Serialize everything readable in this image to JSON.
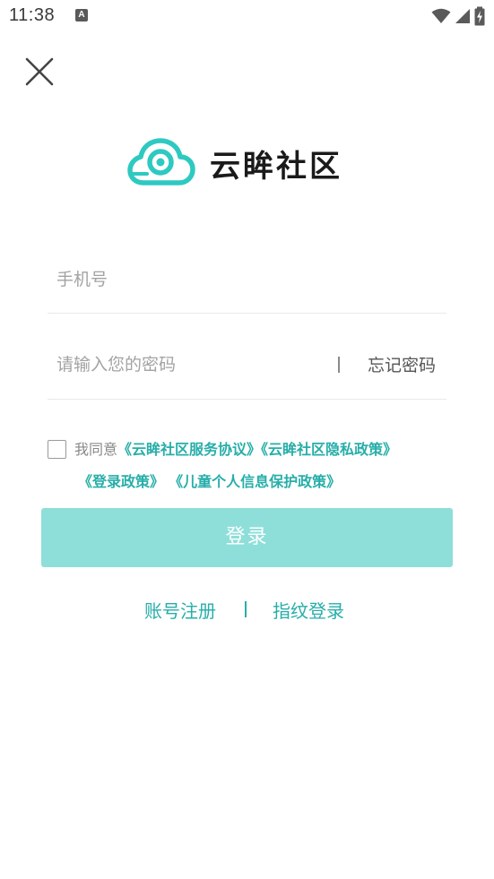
{
  "status_bar": {
    "time": "11:38",
    "notification_icon": "A"
  },
  "logo": {
    "text": "云眸社区",
    "icon": "cloud-eye-icon",
    "color": "#2ec9c1"
  },
  "form": {
    "phone_placeholder": "手机号",
    "password_placeholder": "请输入您的密码",
    "separator": "|",
    "forgot_password": "忘记密码"
  },
  "agreement": {
    "checked": false,
    "prefix": "我同意",
    "policy_service": "《云眸社区服务协议》",
    "policy_privacy": "《云眸社区隐私政策》",
    "policy_login": "《登录政策》",
    "policy_children": "《儿童个人信息保护政策》"
  },
  "login_button": {
    "label": "登录",
    "color": "#8edfd9"
  },
  "bottom_links": {
    "register": "账号注册",
    "fingerprint_login": "指纹登录"
  },
  "colors": {
    "accent": "#27aea9"
  }
}
